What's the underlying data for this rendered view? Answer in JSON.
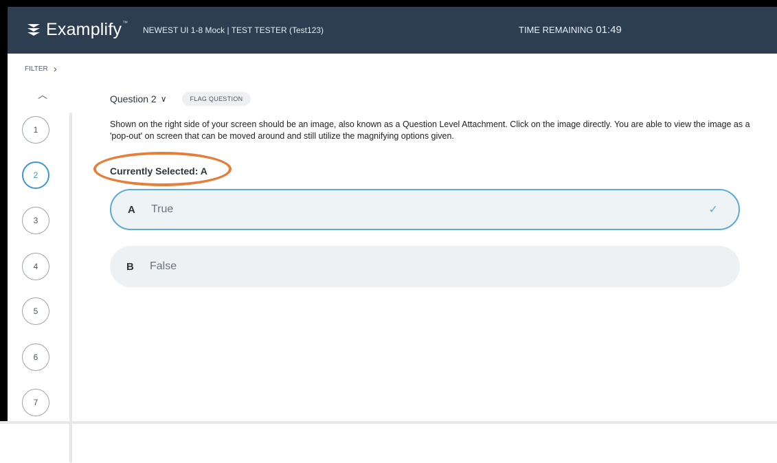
{
  "header": {
    "brand": "Examplify",
    "trademark": "™",
    "exam_title": "NEWEST UI 1-8 Mock | TEST TESTER (Test123)",
    "timer_label": "TIME REMAINING",
    "timer_value": "01:49"
  },
  "sidebar": {
    "filter_label": "FILTER",
    "filter_icon": "chevron-right-icon",
    "scroll_up_icon": "chevron-up-icon",
    "questions": [
      "1",
      "2",
      "3",
      "4",
      "5",
      "6",
      "7"
    ],
    "active_question": "2"
  },
  "question": {
    "selector_label": "Question 2",
    "selector_icon": "chevron-down-icon",
    "flag_label": "FLAG QUESTION",
    "text": "Shown on the right side of your screen should be an image, also known as a Question Level Attachment. Click on the image directly. You are able to view the image as a 'pop-out' on screen that can be moved around and still utilize the magnifying options given.",
    "currently_selected": "Currently Selected: A",
    "answers": [
      {
        "letter": "A",
        "text": "True",
        "selected": true
      },
      {
        "letter": "B",
        "text": "False",
        "selected": false
      }
    ]
  },
  "colors": {
    "header_bg": "#2d3e50",
    "accent": "#3b97d3",
    "highlight": "#e67e3b"
  }
}
